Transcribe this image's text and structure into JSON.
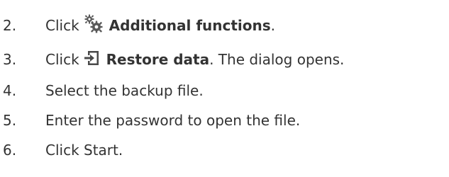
{
  "steps": [
    {
      "number": "2.",
      "prefix": "Click",
      "icon": "gears-icon",
      "action": "Additional functions",
      "suffix": "."
    },
    {
      "number": "3.",
      "prefix": "Click",
      "icon": "restore-icon",
      "action": "Restore data",
      "suffix": ". The dialog opens."
    },
    {
      "number": "4.",
      "text": "Select the backup file."
    },
    {
      "number": "5.",
      "text": "Enter the password to open the file."
    },
    {
      "number": "6.",
      "text": "Click Start."
    }
  ]
}
